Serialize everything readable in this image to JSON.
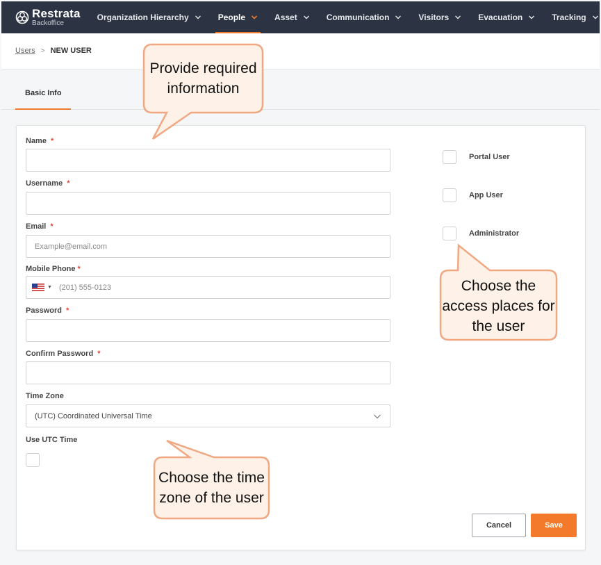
{
  "brand": {
    "name": "Restrata",
    "sub": "Backoffice"
  },
  "nav": [
    {
      "label": "Organization Hierarchy",
      "active": false
    },
    {
      "label": "People",
      "active": true
    },
    {
      "label": "Asset",
      "active": false
    },
    {
      "label": "Communication",
      "active": false
    },
    {
      "label": "Visitors",
      "active": false
    },
    {
      "label": "Evacuation",
      "active": false
    },
    {
      "label": "Tracking",
      "active": false
    }
  ],
  "breadcrumb": {
    "link": "Users",
    "separator": ">",
    "current": "NEW USER"
  },
  "tabs": {
    "basic_info": "Basic Info"
  },
  "form": {
    "name_label": "Name",
    "username_label": "Username",
    "email_label": "Email",
    "email_placeholder": "Example@email.com",
    "mobile_label": "Mobile Phone",
    "mobile_placeholder": "(201) 555-0123",
    "password_label": "Password",
    "confirm_password_label": "Confirm Password",
    "timezone_label": "Time Zone",
    "timezone_value": "(UTC) Coordinated Universal Time",
    "use_utc_label": "Use UTC Time",
    "required_mark": "*"
  },
  "access": {
    "portal_user": "Portal User",
    "app_user": "App User",
    "administrator": "Administrator"
  },
  "buttons": {
    "cancel": "Cancel",
    "save": "Save"
  },
  "callouts": {
    "provide_info": "Provide required information",
    "access_places": "Choose the access places for the user",
    "time_zone": "Choose the time zone of the user"
  },
  "colors": {
    "accent": "#f47a2b",
    "nav_bg": "#2c3443",
    "callout_border": "#f0a882",
    "callout_fill": "#fdf1e8"
  }
}
